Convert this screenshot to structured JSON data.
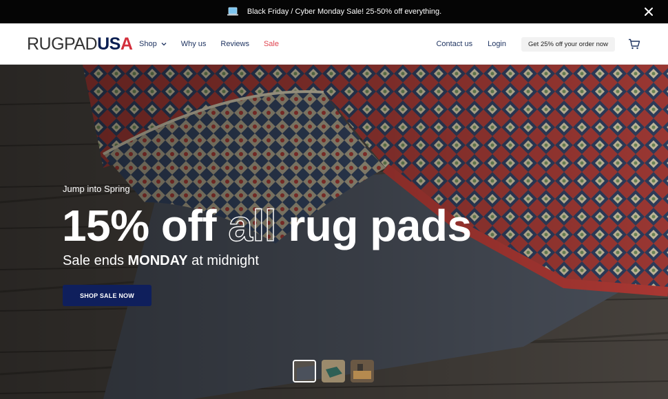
{
  "announcement": {
    "text": "Black Friday / Cyber Monday Sale! 25-50% off everything.",
    "icon": "laptop-icon",
    "close_icon": "close-icon"
  },
  "header": {
    "logo": {
      "part1": "RUGPAD",
      "part2": "US",
      "part3": "A"
    },
    "nav": [
      {
        "label": "Shop",
        "has_dropdown": true
      },
      {
        "label": "Why us"
      },
      {
        "label": "Reviews"
      },
      {
        "label": "Sale"
      }
    ],
    "contact_label": "Contact us",
    "login_label": "Login",
    "promo_label": "Get 25% off your order now",
    "cart_icon": "cart-icon"
  },
  "hero": {
    "eyebrow": "Jump into Spring",
    "headline_part1": "15% off ",
    "headline_outline": "all",
    "headline_part2": " rug pads",
    "subhead_prefix": "Sale ends ",
    "subhead_bold": "MONDAY",
    "subhead_suffix": " at midnight",
    "cta_label": "SHOP SALE NOW",
    "carousel": {
      "count": 3,
      "active_index": 0
    }
  },
  "colors": {
    "brand_navy": "#0f1f5c",
    "brand_red": "#d32f3c",
    "sale_red": "#e0434f",
    "nav_text": "#1f3461"
  }
}
